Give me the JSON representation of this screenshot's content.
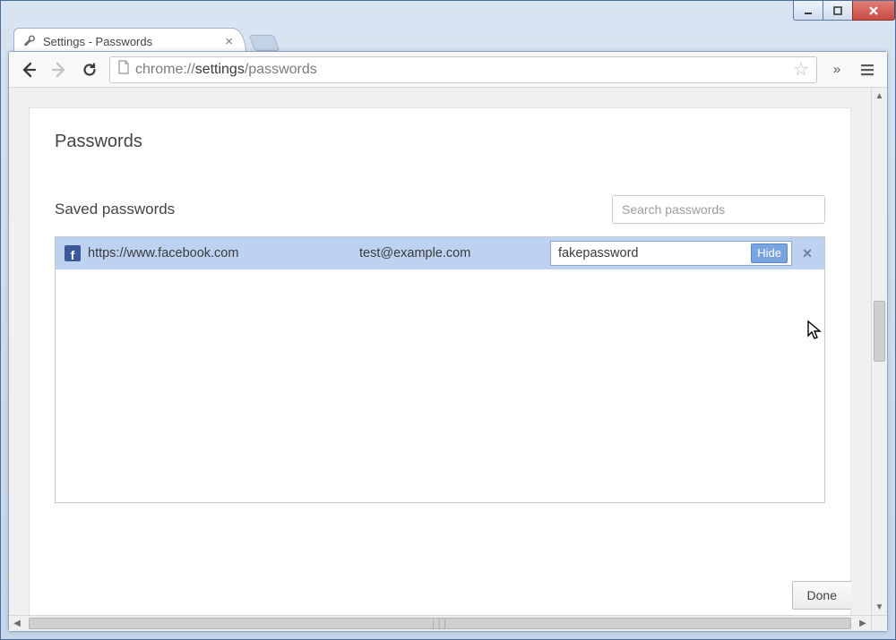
{
  "tab": {
    "title": "Settings - Passwords"
  },
  "omnibox": {
    "scheme": "chrome://",
    "host": "settings",
    "path": "/passwords"
  },
  "page": {
    "title": "Passwords",
    "section_title": "Saved passwords",
    "search_placeholder": "Search passwords",
    "done_label": "Done"
  },
  "passwords": [
    {
      "site": "https://www.facebook.com",
      "username": "test@example.com",
      "password": "fakepassword",
      "toggle_label": "Hide",
      "favicon_letter": "f"
    }
  ]
}
